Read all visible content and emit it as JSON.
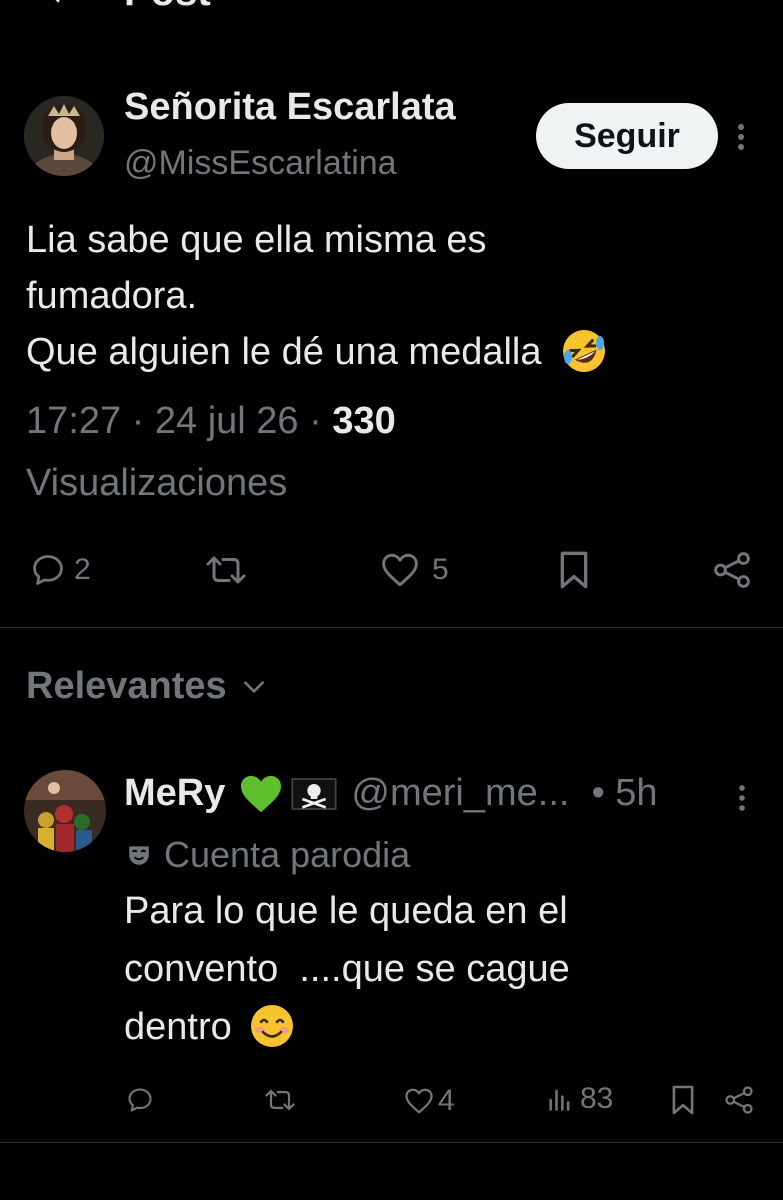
{
  "header": {
    "title": "Post"
  },
  "post": {
    "author_name": "Señorita Escarlata",
    "author_handle": "@MissEscarlatina",
    "follow_label": "Seguir",
    "text_lines": [
      "Lia sabe que ella misma es",
      "fumadora.",
      "Que alguien le dé una medalla"
    ],
    "text_emoji": "rolling-on-floor-laughing-emoji",
    "time": "17:27",
    "date": "24 jul 26",
    "views_count": "330",
    "views_label": "Visualizaciones",
    "actions": {
      "replies": "2",
      "reposts": "",
      "likes": "5"
    }
  },
  "section": {
    "title": "Relevantes"
  },
  "reply": {
    "author_name": "MeRy",
    "author_badges": [
      "green-heart-emoji",
      "pirate-flag-emoji"
    ],
    "author_handle": "@meri_me...",
    "time": "• 5h",
    "parody_label": "Cuenta parodia",
    "text_lines": [
      "Para lo que le queda en el",
      "convento  ....que se cague",
      "dentro"
    ],
    "text_emoji": "smiling-face-emoji",
    "actions": {
      "replies": "",
      "reposts": "",
      "likes": "4",
      "views": "83"
    }
  },
  "colors": {
    "background": "#000000",
    "text": "#e7e9ea",
    "muted": "#71767b",
    "divider": "#2f3336",
    "button_bg": "#eff3f4"
  }
}
